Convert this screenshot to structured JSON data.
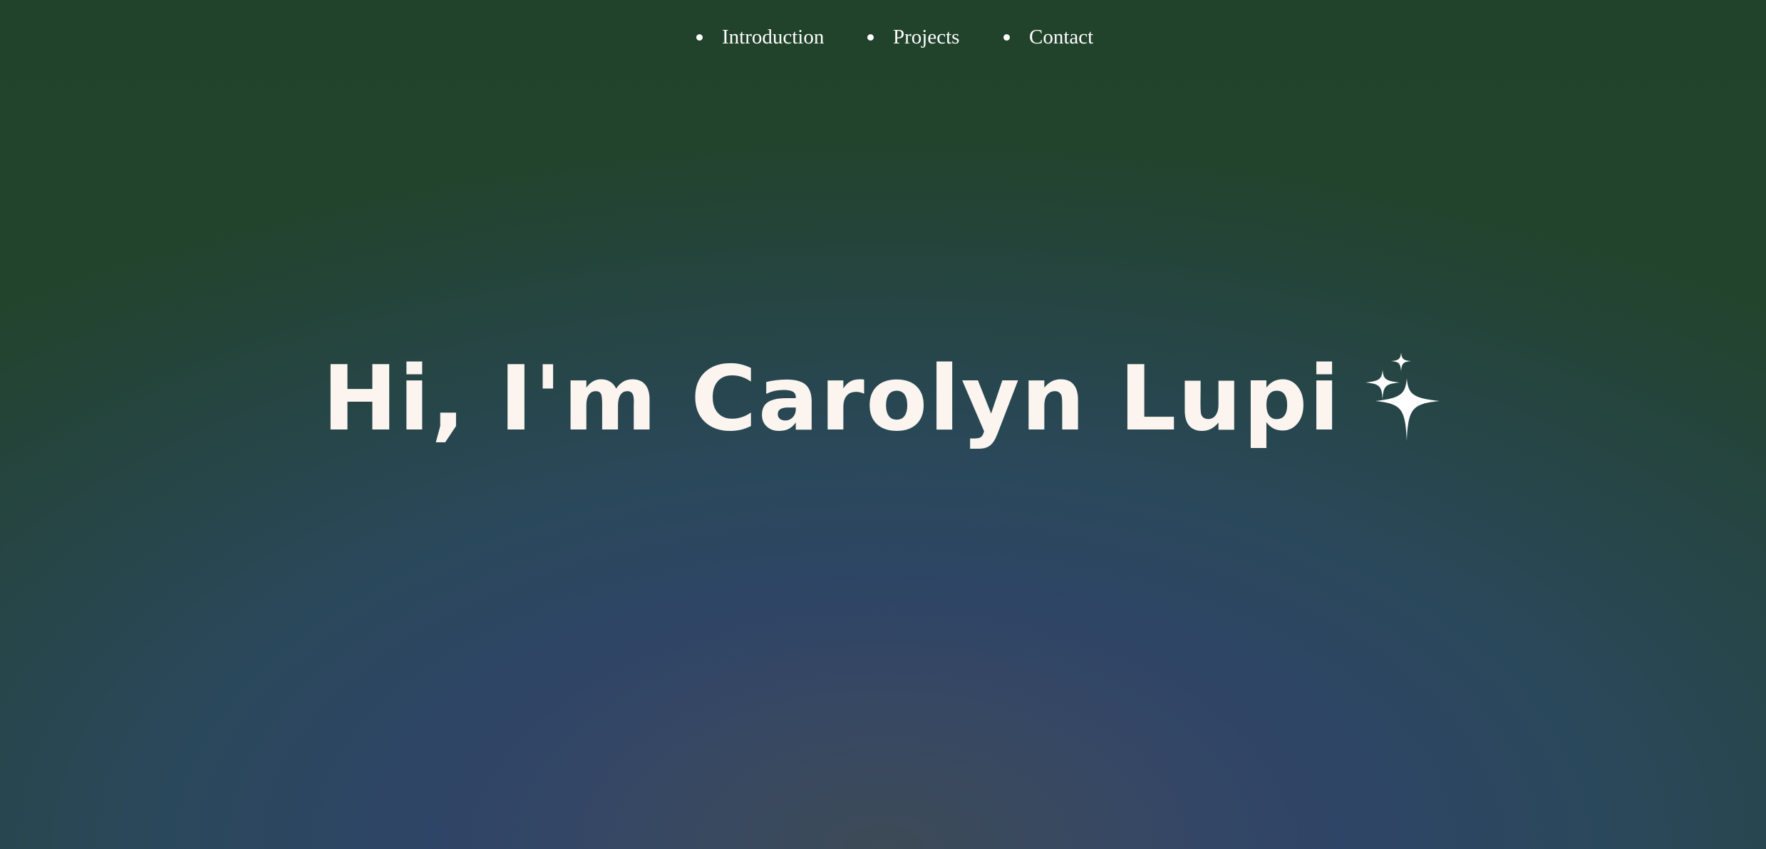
{
  "nav": {
    "items": [
      {
        "label": "Introduction"
      },
      {
        "label": "Projects"
      },
      {
        "label": "Contact"
      }
    ]
  },
  "hero": {
    "title": "Hi, I'm Carolyn Lupi",
    "icon": "sparkles-icon"
  },
  "colors": {
    "text": "#fbf4ef",
    "nav_text": "#ffffff",
    "background_top": "#22432b",
    "background_glow": "#33467a"
  }
}
